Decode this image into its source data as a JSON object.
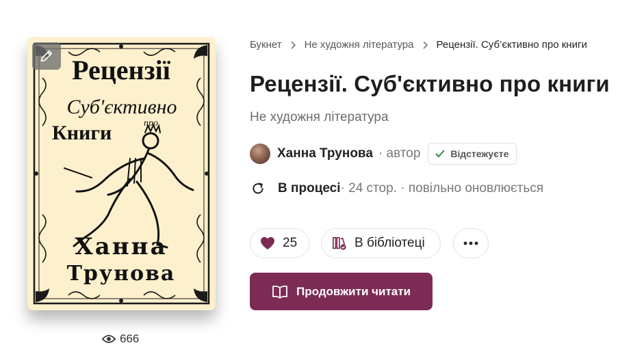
{
  "cover": {
    "line1": "Рецензії",
    "line2": "Суб'єктивно",
    "line3_small": "про",
    "line4": "Книги",
    "author1": "Ханна",
    "author2": "Трунова"
  },
  "views": "666",
  "breadcrumb": [
    "Букнет",
    "Не художня література",
    "Рецензії. Суб’єктивно про книги"
  ],
  "title": "Рецензії. Суб'єктивно про книги",
  "genre": "Не художня література",
  "author": {
    "name": "Ханна Трунова",
    "role": "· автор",
    "follow_label": "Відстежуєте"
  },
  "status": {
    "state": "В процесі",
    "details": " · 24 стор. · повільно оновлюється"
  },
  "actions": {
    "likes": "25",
    "library_label": "В бібліотеці",
    "read_label": "Продовжити читати"
  },
  "colors": {
    "accent": "#7c2c54",
    "cover_bg": "#fdf0cc",
    "follow_check": "#2e8b3e"
  }
}
